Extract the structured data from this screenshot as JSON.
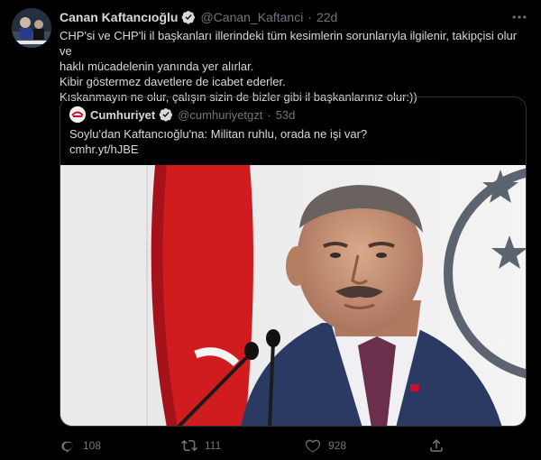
{
  "tweet": {
    "display_name": "Canan Kaftancıoğlu",
    "handle": "@Canan_Kaftanci",
    "separator": "·",
    "time": "22d",
    "lines": [
      "CHP'si ve CHP'li il başkanları illerindeki tüm kesimlerin sorunlarıyla ilgilenir, takipçisi olur ve",
      "haklı mücadelenin yanında yer alırlar.",
      "Kibir göstermez davetlere de icabet ederler.",
      "Kıskanmayın ne olur, çalışın sizin de bizler gibi il başkanlarınız olur:))"
    ]
  },
  "quote": {
    "display_name": "Cumhuriyet",
    "handle": "@cumhuriyetgzt",
    "separator": "·",
    "time": "53d",
    "text": "Soylu'dan Kaftancıoğlu'na: Militan ruhlu, orada ne işi var?",
    "link": "cmhr.yt/hJBE"
  },
  "actions": {
    "replies": "108",
    "retweets": "111",
    "likes": "928"
  },
  "icons": {
    "verified": "verified-badge-icon",
    "more": "more-options-icon",
    "reply": "reply-icon",
    "retweet": "retweet-icon",
    "like": "heart-icon",
    "share": "share-icon"
  },
  "colors": {
    "background": "#000000",
    "text": "#d9d9d9",
    "muted": "#6e767d",
    "verified": "#1d9bf0",
    "border": "#2f3336"
  }
}
